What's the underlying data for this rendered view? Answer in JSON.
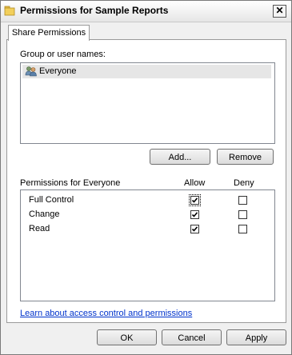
{
  "window": {
    "title": "Permissions for Sample Reports",
    "close_glyph": "✕"
  },
  "tab": {
    "label": "Share Permissions"
  },
  "group_section": {
    "label": "Group or user names:",
    "users": [
      {
        "name": "Everyone",
        "selected": true
      }
    ],
    "add_label": "Add...",
    "remove_label": "Remove"
  },
  "permissions": {
    "header": "Permissions for Everyone",
    "allow_header": "Allow",
    "deny_header": "Deny",
    "rows": [
      {
        "name": "Full Control",
        "allow": true,
        "deny": false
      },
      {
        "name": "Change",
        "allow": true,
        "deny": false
      },
      {
        "name": "Read",
        "allow": true,
        "deny": false
      }
    ]
  },
  "help_link": "Learn about access control and permissions",
  "footer": {
    "ok_label": "OK",
    "cancel_label": "Cancel",
    "apply_label": "Apply"
  },
  "icons": {
    "title": "folder-icon",
    "user": "users-group-icon"
  }
}
